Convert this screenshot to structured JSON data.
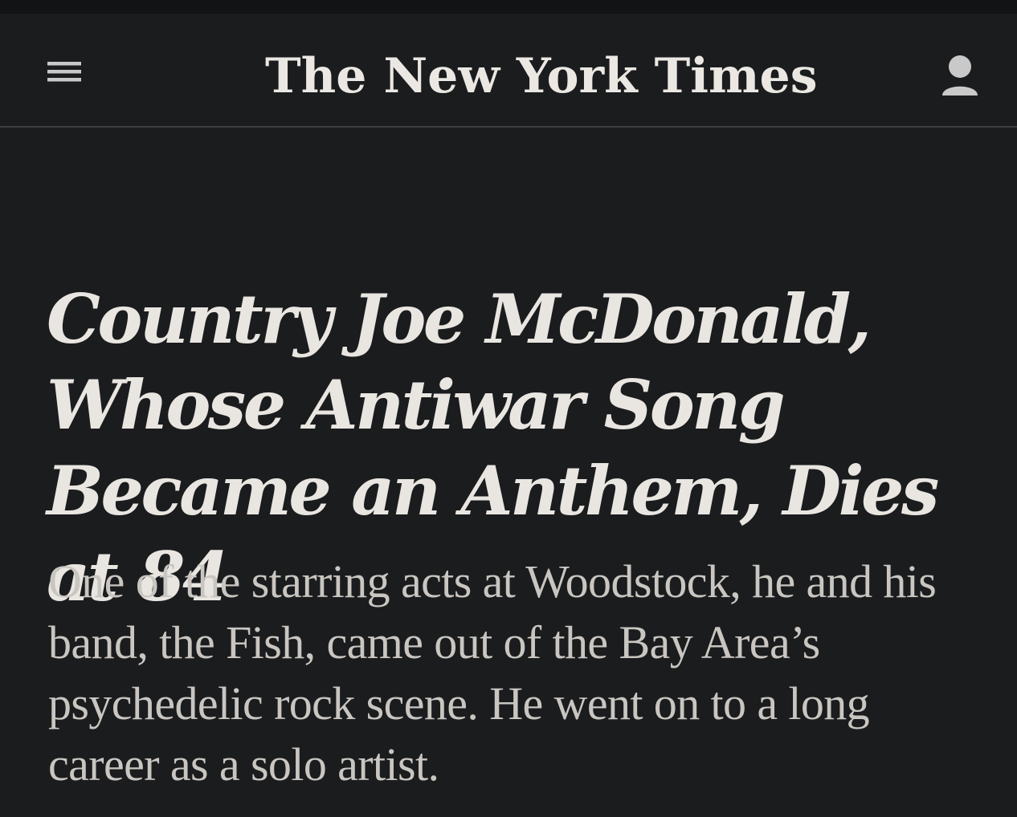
{
  "masthead": {
    "logo_text": "The New York Times",
    "menu_icon": "hamburger-menu-icon",
    "account_icon": "user-account-icon"
  },
  "article": {
    "headline": "Country Joe McDonald, Whose Antiwar Song Became an Anthem, Dies at 84",
    "summary": "One of the starring acts at Woodstock, he and his band, the Fish, came out of the Bay Area’s psychedelic rock scene. He went on to a long career as a solo artist."
  },
  "colors": {
    "background": "#1b1c1e",
    "headline_text": "#e9e6e1",
    "summary_text": "#c9c6c1",
    "icon": "#c9c9c9"
  }
}
